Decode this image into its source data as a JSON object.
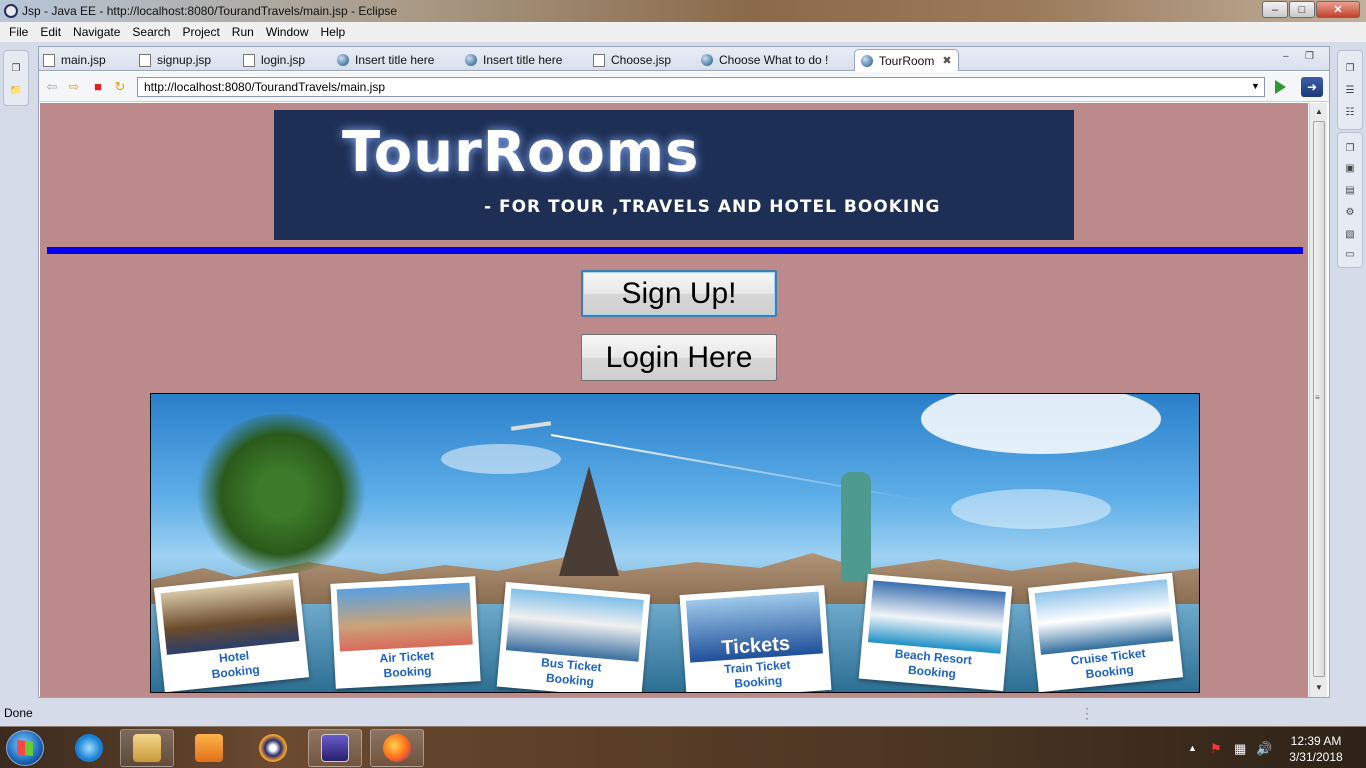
{
  "window": {
    "title": "Jsp - Java EE - http://localhost:8080/TourandTravels/main.jsp - Eclipse",
    "min_label": "‒",
    "max_label": "□",
    "close_label": "✕"
  },
  "menu": [
    "File",
    "Edit",
    "Navigate",
    "Search",
    "Project",
    "Run",
    "Window",
    "Help"
  ],
  "tabs": [
    {
      "label": "main.jsp",
      "icon": "jsp-file-icon"
    },
    {
      "label": "signup.jsp",
      "icon": "jsp-file-icon"
    },
    {
      "label": "login.jsp",
      "icon": "jsp-file-icon"
    },
    {
      "label": "Insert title here",
      "icon": "globe-icon"
    },
    {
      "label": "Insert title here",
      "icon": "globe-icon"
    },
    {
      "label": "Choose.jsp",
      "icon": "jsp-file-icon"
    },
    {
      "label": "Choose What to do !",
      "icon": "globe-icon"
    },
    {
      "label": "TourRoom",
      "icon": "globe-icon",
      "active": true
    }
  ],
  "browser": {
    "url": "http://localhost:8080/TourandTravels/main.jsp"
  },
  "page": {
    "banner_title": "TourRooms",
    "banner_subtitle": "-  FOR TOUR ,TRAVELS AND HOTEL BOOKING",
    "signup_label": "Sign Up!",
    "login_label": "Login Here",
    "rule_color": "#0000ee",
    "background_color": "#bc8a8a",
    "image_cards": [
      {
        "line1": "Hotel",
        "line2": "Booking"
      },
      {
        "line1": "Air Ticket",
        "line2": "Booking"
      },
      {
        "line1": "Bus Ticket",
        "line2": "Booking"
      },
      {
        "line1": "Train Ticket",
        "line2": "Booking"
      },
      {
        "line1": "Beach Resort",
        "line2": "Booking"
      },
      {
        "line1": "Cruise Ticket",
        "line2": "Booking"
      }
    ],
    "tickets_word": "Tickets"
  },
  "status": {
    "text": "Done"
  },
  "clock": {
    "time": "12:39 AM",
    "date": "3/31/2018"
  }
}
